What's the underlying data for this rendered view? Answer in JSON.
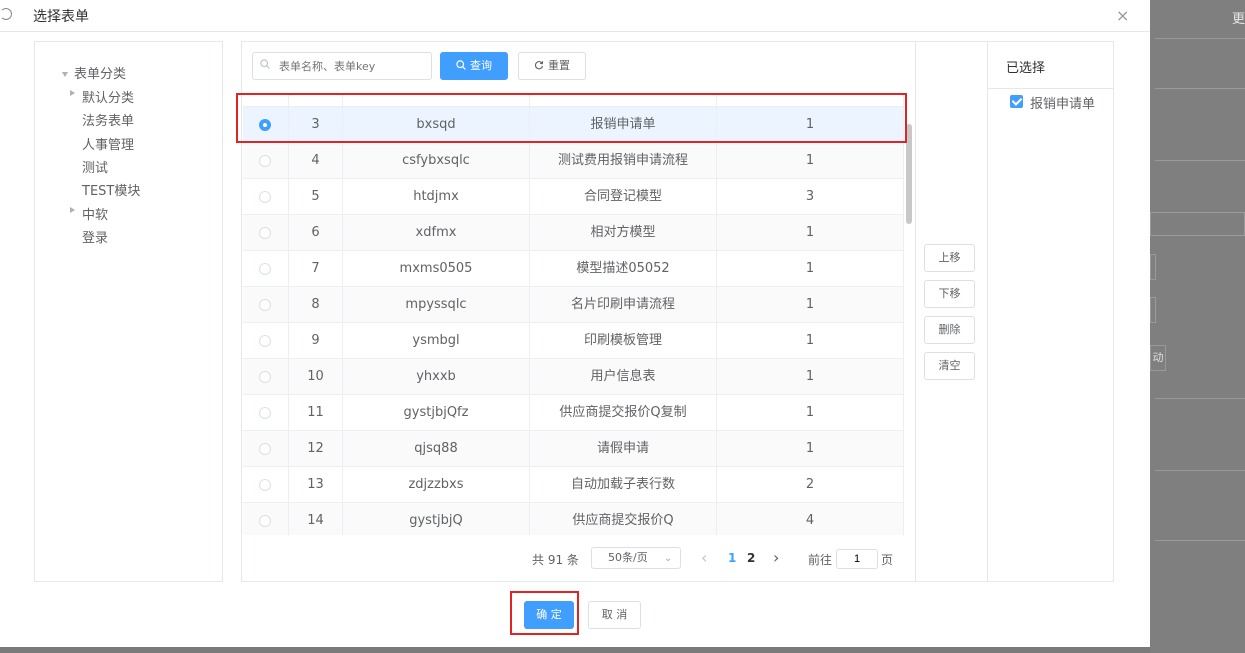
{
  "dialog": {
    "title": "选择表单",
    "close_icon": "×"
  },
  "background": {
    "edge_text": "更",
    "edge_button": "动"
  },
  "tree": {
    "root": "表单分类",
    "items": [
      "默认分类",
      "法务表单",
      "人事管理",
      "测试",
      "TEST模块",
      "中软",
      "登录"
    ]
  },
  "search": {
    "placeholder": "表单名称、表单key",
    "query_label": "查询",
    "reset_label": "重置"
  },
  "table": {
    "rows": [
      {
        "num": "3",
        "key": "bxsqd",
        "name": "报销申请单",
        "version": "1",
        "selected": true
      },
      {
        "num": "4",
        "key": "csfybxsqlc",
        "name": "测试费用报销申请流程",
        "version": "1"
      },
      {
        "num": "5",
        "key": "htdjmx",
        "name": "合同登记模型",
        "version": "3"
      },
      {
        "num": "6",
        "key": "xdfmx",
        "name": "相对方模型",
        "version": "1"
      },
      {
        "num": "7",
        "key": "mxms0505",
        "name": "模型描述05052",
        "version": "1"
      },
      {
        "num": "8",
        "key": "mpyssqlc",
        "name": "名片印刷申请流程",
        "version": "1"
      },
      {
        "num": "9",
        "key": "ysmbgl",
        "name": "印刷模板管理",
        "version": "1"
      },
      {
        "num": "10",
        "key": "yhxxb",
        "name": "用户信息表",
        "version": "1"
      },
      {
        "num": "11",
        "key": "gystjbjQfz",
        "name": "供应商提交报价Q复制",
        "version": "1"
      },
      {
        "num": "12",
        "key": "qjsq88",
        "name": "请假申请",
        "version": "1"
      },
      {
        "num": "13",
        "key": "zdjzzbxs",
        "name": "自动加载子表行数",
        "version": "2"
      },
      {
        "num": "14",
        "key": "gystjbjQ",
        "name": "供应商提交报价Q",
        "version": "4"
      }
    ]
  },
  "pagination": {
    "total": "共 91 条",
    "page_size": "50条/页",
    "prev": "‹",
    "page1": "1",
    "page2": "2",
    "next": "›",
    "goto_prefix": "前往",
    "goto_value": "1",
    "goto_suffix": "页"
  },
  "actions": {
    "up": "上移",
    "down": "下移",
    "delete": "删除",
    "clear": "清空"
  },
  "selected_panel": {
    "title": "已选择",
    "items": [
      "报销申请单"
    ]
  },
  "footer": {
    "confirm": "确 定",
    "cancel": "取 消"
  },
  "colors": {
    "primary": "#409eff",
    "highlight": "#e02424"
  }
}
